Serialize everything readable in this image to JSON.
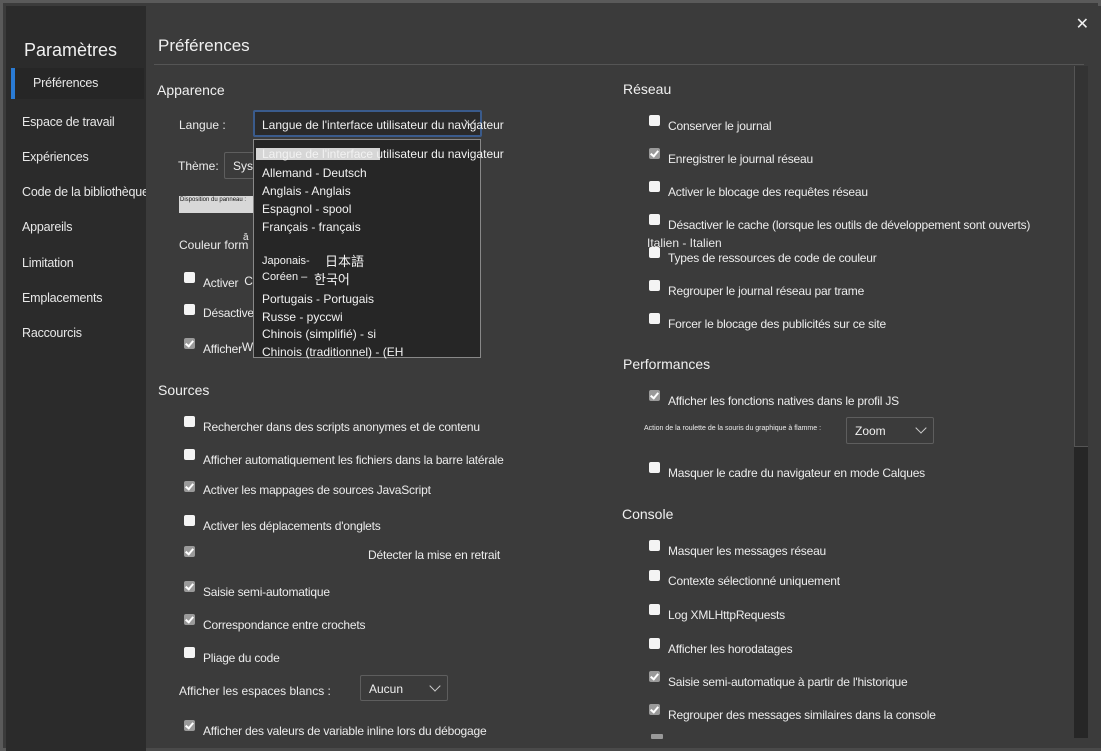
{
  "sidebar": {
    "title": "Paramètres",
    "items": [
      {
        "label": "Préférences",
        "active": true
      },
      {
        "label": "Espace de travail"
      },
      {
        "label": "Expériences"
      },
      {
        "label": "Code de la bibliothèque"
      },
      {
        "label": "Appareils"
      },
      {
        "label": "Limitation"
      },
      {
        "label": "Emplacements"
      },
      {
        "label": "Raccourcis"
      }
    ]
  },
  "header": {
    "title": "Préférences",
    "close_icon": "close-icon"
  },
  "appearance": {
    "title": "Apparence",
    "language_label": "Langue :",
    "language_value": "Langue de l'interface utilisateur du navigateur",
    "language_options": [
      "Langue de l'interface utilisateur du navigateur",
      "Allemand - Deutsch",
      "Anglais - Anglais",
      "Espagnol - spool",
      "Français - français",
      "Japonais-",
      "日本語",
      "Coréen –",
      "한국어",
      "Portugais - Portugais",
      "Russe - pyccwi",
      "Chinois (simplifié) - si",
      "Chinois (traditionnel) - (EH"
    ],
    "theme_label": "Thème:",
    "theme_value": "Syst",
    "panel_layout_label": "Disposition du panneau :",
    "color_format_label": "Couleur form",
    "color_format_fragment": "ā",
    "checkboxes": [
      {
        "label": "Activer",
        "trailing": "C",
        "checked": false
      },
      {
        "label": "Désactiver",
        "trailing": "r",
        "checked": false
      },
      {
        "label": "Afficher",
        "trailing": "We",
        "checked": true
      }
    ]
  },
  "sources": {
    "title": "Sources",
    "checkboxes": [
      {
        "label": "Rechercher dans des scripts anonymes et de contenu",
        "checked": false
      },
      {
        "label": "Afficher automatiquement les fichiers dans la barre latérale",
        "checked": false
      },
      {
        "label": "Activer les mappages de sources JavaScript",
        "checked": true
      },
      {
        "label": "Activer les déplacements d'onglets",
        "checked": false
      },
      {
        "label": "Détecter la mise en retrait",
        "checked": true
      },
      {
        "label": "Saisie semi-automatique",
        "checked": true
      },
      {
        "label": "Correspondance entre crochets",
        "checked": true
      },
      {
        "label": "Pliage du code",
        "checked": false
      }
    ],
    "whitespace_label": "Afficher les espaces blancs :",
    "whitespace_value": "Aucun",
    "inline_values": {
      "label": "Afficher des valeurs de variable inline lors du débogage",
      "checked": true
    }
  },
  "network": {
    "title": "Réseau",
    "checkboxes": [
      {
        "label": "Conserver le journal",
        "checked": false
      },
      {
        "label": "Enregistrer le journal réseau",
        "checked": true
      },
      {
        "label": "Activer le blocage des requêtes réseau",
        "checked": false
      },
      {
        "label": "Désactiver le cache (lorsque les outils de développement sont ouverts)",
        "checked": false
      },
      {
        "label": "Types de ressources de code de couleur",
        "checked": false
      },
      {
        "label": "Regrouper le journal réseau par trame",
        "checked": false
      },
      {
        "label": "Forcer le blocage des publicités sur ce site",
        "checked": false
      }
    ],
    "stray_option": "Italien - Italien"
  },
  "performance": {
    "title": "Performances",
    "native_functions": {
      "label": "Afficher les fonctions natives dans le profil JS",
      "checked": true
    },
    "flame_wheel_label": "Action de la roulette de la souris du graphique à flamme :",
    "flame_wheel_value": "Zoom",
    "hide_frame": {
      "label": "Masquer le cadre du navigateur en mode Calques",
      "checked": false
    }
  },
  "console": {
    "title": "Console",
    "checkboxes": [
      {
        "label": "Masquer les messages réseau",
        "checked": false
      },
      {
        "label": "Contexte sélectionné uniquement",
        "checked": false
      },
      {
        "label": "Log XMLHttpRequests",
        "checked": false
      },
      {
        "label": "Afficher les horodatages",
        "checked": false
      },
      {
        "label": "Saisie semi-automatique à partir de l'historique",
        "checked": true
      },
      {
        "label": "Regrouper des messages similaires dans la console",
        "checked": true
      }
    ]
  },
  "colors": {
    "accent": "#2a7bd4",
    "background": "#3b3b3b",
    "sidebar": "#2b2b2b"
  }
}
